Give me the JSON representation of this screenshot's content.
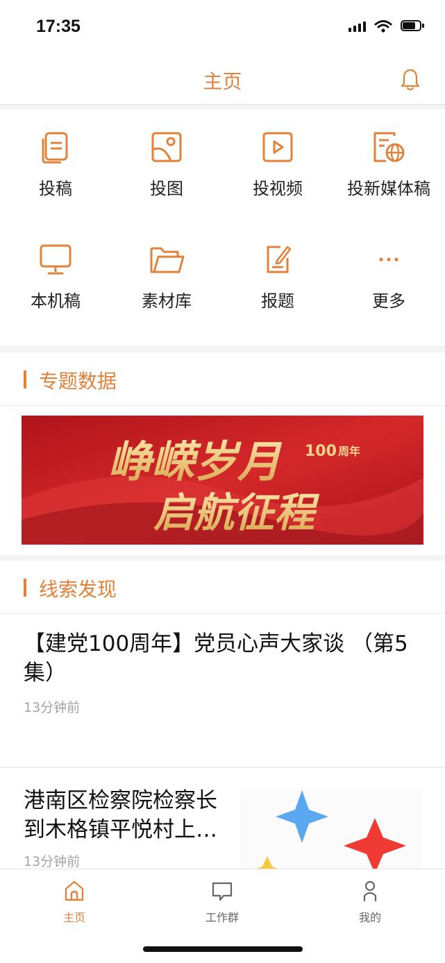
{
  "status": {
    "time": "17:35"
  },
  "header": {
    "title": "主页"
  },
  "colors": {
    "accent": "#e0823a",
    "banner_red": "#c8231f",
    "gold": "#f3d48a"
  },
  "grid": [
    {
      "label": "投稿",
      "icon": "document-icon"
    },
    {
      "label": "投图",
      "icon": "image-icon"
    },
    {
      "label": "投视频",
      "icon": "video-icon"
    },
    {
      "label": "投新媒体稿",
      "icon": "globe-document-icon"
    },
    {
      "label": "本机稿",
      "icon": "monitor-icon"
    },
    {
      "label": "素材库",
      "icon": "folder-icon"
    },
    {
      "label": "报题",
      "icon": "edit-document-icon"
    },
    {
      "label": "更多",
      "icon": "more-icon"
    }
  ],
  "sections": {
    "special_data": {
      "title": "专题数据"
    },
    "clues": {
      "title": "线索发现"
    }
  },
  "banner": {
    "line1": "峥嵘岁月",
    "line2": "启航征程",
    "badge_number": "100",
    "badge_text": "周年"
  },
  "news": [
    {
      "title": "【建党100周年】党员心声大家谈 （第5集）",
      "time": "13分钟前"
    },
    {
      "title": "港南区检察院检察长到木格镇平悦村上…",
      "time": "13分钟前"
    }
  ],
  "tabs": [
    {
      "label": "主页",
      "icon": "home-icon",
      "active": true
    },
    {
      "label": "工作群",
      "icon": "chat-icon",
      "active": false
    },
    {
      "label": "我的",
      "icon": "person-icon",
      "active": false
    }
  ]
}
